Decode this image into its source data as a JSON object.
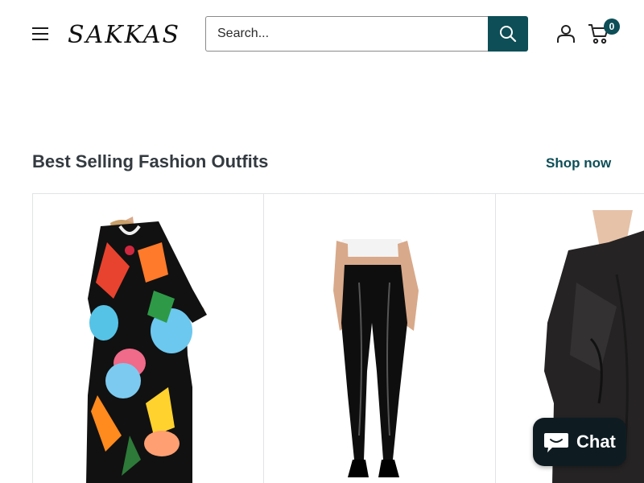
{
  "header": {
    "logo_text": "SAKKAS",
    "search": {
      "placeholder": "Search..."
    },
    "cart_count": "0"
  },
  "section": {
    "title": "Best Selling Fashion Outfits",
    "shop_now_label": "Shop now"
  },
  "products": [
    {
      "image": "kaftan-dress-photo"
    },
    {
      "image": "faux-leather-leggings-photo"
    },
    {
      "image": "black-shawl-photo"
    }
  ],
  "chat": {
    "label": "Chat"
  },
  "colors": {
    "accent": "#0d4e57",
    "chat_bg": "#0e1c22",
    "border": "#e1e3e4",
    "title": "#333a40"
  }
}
